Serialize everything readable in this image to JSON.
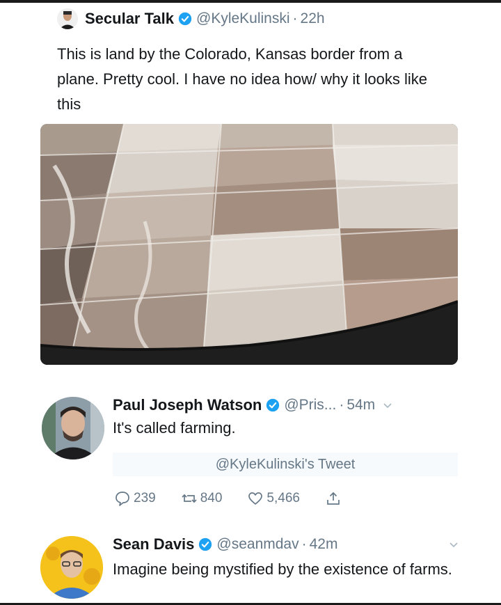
{
  "tweet1": {
    "name": "Secular Talk",
    "handle": "@KyleKulinski",
    "dot": "·",
    "time": "22h",
    "text": "This is land by the Colorado, Kansas border from a plane. Pretty cool. I have no idea how/ why it looks like this"
  },
  "reply1": {
    "name": "Paul Joseph Watson",
    "handle": "@Pris...",
    "dot": "·",
    "time": "54m",
    "text": "It's called farming.",
    "quoted": "@KyleKulinski's Tweet",
    "replies": "239",
    "retweets": "840",
    "likes": "5,466"
  },
  "reply2": {
    "name": "Sean Davis",
    "handle": "@seanmdav",
    "dot": "·",
    "time": "42m",
    "text": "Imagine being mystified by the existence of farms."
  },
  "colors": {
    "verified": "#1da1f2",
    "secondary_text": "#657786",
    "primary_text": "#14171a"
  }
}
